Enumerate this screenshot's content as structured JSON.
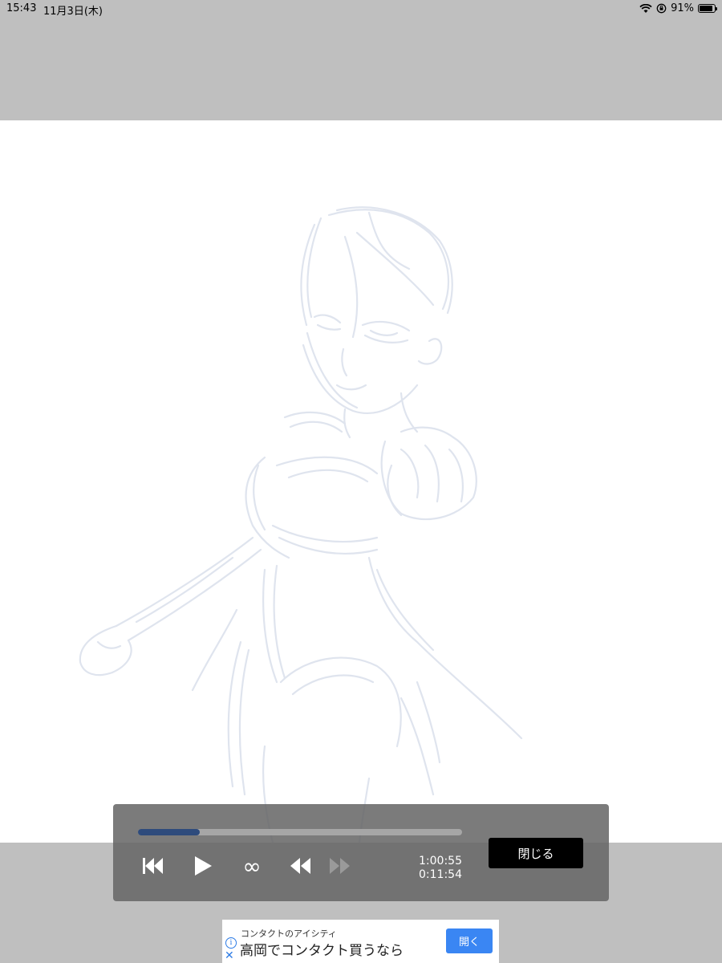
{
  "status": {
    "time": "15:43",
    "date": "11月3日(木)",
    "battery": "91%",
    "battery_level": 0.91
  },
  "player": {
    "progress": 0.19,
    "total_time": "1:00:55",
    "current_time": "0:11:54",
    "close_label": "閉じる",
    "loop_glyph": "∞",
    "accent_color": "#2e4b7c"
  },
  "ad": {
    "small_text": "コンタクトのアイシティ",
    "headline": "高岡でコンタクト買うなら",
    "open_label": "開く",
    "button_color": "#3a86f3"
  }
}
